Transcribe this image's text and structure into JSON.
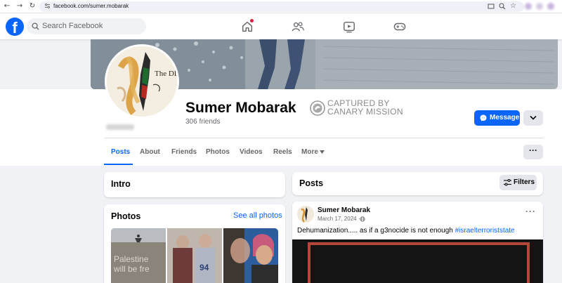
{
  "browser": {
    "url": "facebook.com/sumer.mobarak"
  },
  "header": {
    "logo": "f",
    "search_placeholder": "Search Facebook"
  },
  "profile": {
    "name": "Sumer Mobarak",
    "friends": "306 friends",
    "message_button": "Message",
    "watermark_line1": "CAPTURED BY",
    "watermark_line2": "CANARY MISSION",
    "avatar_text": "The DDT"
  },
  "tabs": [
    {
      "label": "Posts",
      "active": true
    },
    {
      "label": "About"
    },
    {
      "label": "Friends"
    },
    {
      "label": "Photos"
    },
    {
      "label": "Videos"
    },
    {
      "label": "Reels"
    },
    {
      "label": "More"
    }
  ],
  "intro": {
    "title": "Intro"
  },
  "photos": {
    "title": "Photos",
    "see_all": "See all photos",
    "items": [
      {
        "caption_line1": "Palestine",
        "caption_line2": "will be fre"
      },
      {
        "caption": "94"
      },
      {
        "caption": ""
      }
    ]
  },
  "posts": {
    "title": "Posts",
    "filters_label": "Filters",
    "items": [
      {
        "author": "Sumer Mobarak",
        "date": "March 17, 2024 ·",
        "text": "Dehumanization..... as if a g3nocide is not enough",
        "hashtag": "#israelterroriststate"
      }
    ]
  },
  "colors": {
    "fb_blue": "#0866ff",
    "page_bg": "#f0f2f5",
    "secondary_text": "#65676b",
    "notification_red": "#e41e3f"
  }
}
